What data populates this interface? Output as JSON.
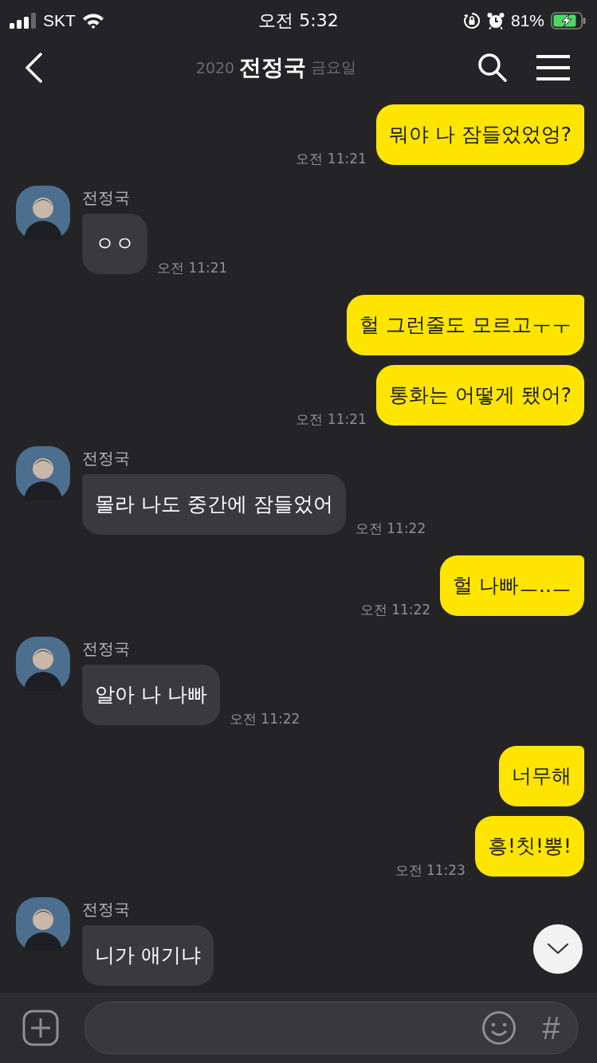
{
  "status_bar": {
    "carrier": "SKT",
    "time": "오전 5:32",
    "battery": "81%"
  },
  "header": {
    "title": "전정국",
    "date_banner": [
      "2020",
      "금요일"
    ]
  },
  "messages": [
    {
      "kind": "sent",
      "bubbles": [
        "뭐야 나 잠들었었엉?"
      ],
      "time": "오전 11:21"
    },
    {
      "kind": "received",
      "sender": "전정국",
      "bubbles": [
        "ㅇㅇ"
      ],
      "time": "오전 11:21"
    },
    {
      "kind": "sent",
      "bubbles": [
        "헐 그런줄도 모르고ㅜㅜ",
        "통화는 어떻게 됐어?"
      ],
      "time": "오전 11:21"
    },
    {
      "kind": "received",
      "sender": "전정국",
      "bubbles": [
        "몰라 나도 중간에 잠들었어"
      ],
      "time": "오전 11:22"
    },
    {
      "kind": "sent",
      "bubbles": [
        "헐 나빠ㅡ..ㅡ"
      ],
      "time": "오전 11:22"
    },
    {
      "kind": "received",
      "sender": "전정국",
      "bubbles": [
        "알아 나 나빠"
      ],
      "time": "오전 11:22"
    },
    {
      "kind": "sent",
      "bubbles": [
        "너무해",
        "흥!칫!뿡!"
      ],
      "time": "오전 11:23"
    },
    {
      "kind": "received",
      "sender": "전정국",
      "bubbles": [
        "니가 애기냐"
      ]
    }
  ],
  "input_bar": {
    "hashtag": "#"
  }
}
